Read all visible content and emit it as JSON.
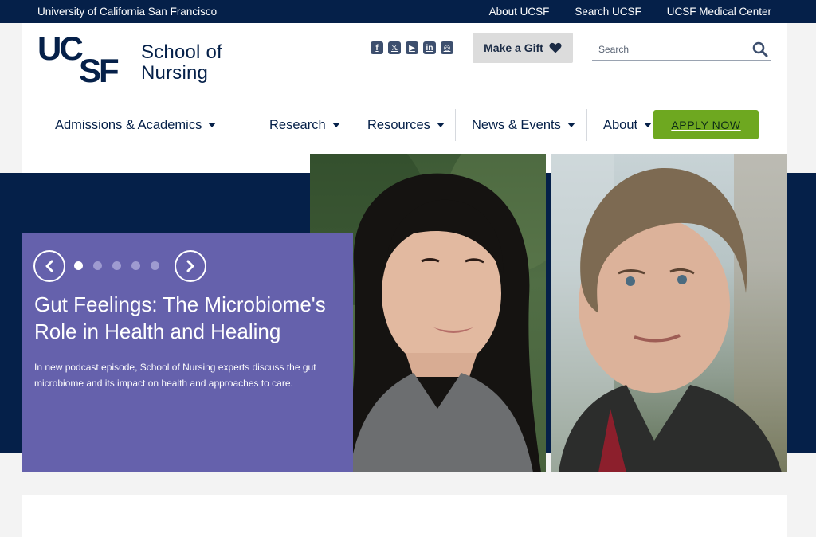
{
  "topbar": {
    "university": "University of California San Francisco",
    "links": [
      "About UCSF",
      "Search UCSF",
      "UCSF Medical Center"
    ]
  },
  "logo": {
    "mark": "UCSF",
    "line1": "School of",
    "line2": "Nursing"
  },
  "social": {
    "icons": [
      "facebook-icon",
      "x-icon",
      "youtube-icon",
      "linkedin-icon",
      "instagram-icon"
    ]
  },
  "gift": {
    "label": "Make a Gift",
    "icon": "heart-icon"
  },
  "search": {
    "placeholder": "Search",
    "icon": "search-icon"
  },
  "nav": {
    "items": [
      {
        "label": "Admissions & Academics"
      },
      {
        "label": "Research"
      },
      {
        "label": "Resources"
      },
      {
        "label": "News & Events"
      },
      {
        "label": "About"
      }
    ],
    "cta": "APPLY NOW"
  },
  "hero": {
    "title": "Gut Feelings: The Microbiome's Role in Health and Healing",
    "description": "In new podcast episode, School of Nursing experts discuss the gut microbiome and its impact on health and approaches to care.",
    "slide_count": 5,
    "active_slide": 1
  },
  "colors": {
    "navy": "#052049",
    "purple": "#6561ac",
    "green": "#6ea820",
    "gray": "#dcdcdc"
  }
}
